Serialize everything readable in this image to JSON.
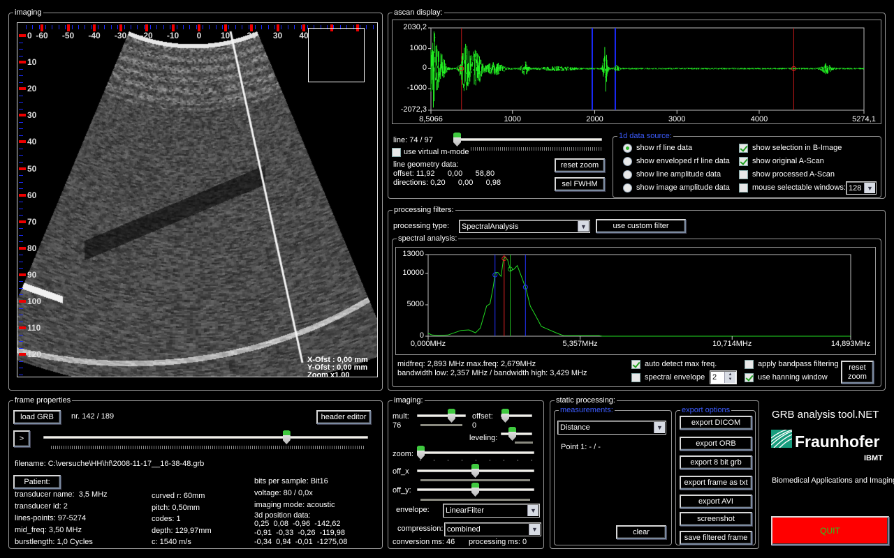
{
  "imaging_view": {
    "legend": "imaging",
    "x_ruler_labels": [
      "-60",
      "-50",
      "-40",
      "-30",
      "-20",
      "-10",
      "0",
      "10",
      "20",
      "30",
      "40"
    ],
    "y_ruler_labels": [
      "0",
      "10",
      "20",
      "30",
      "40",
      "50",
      "60",
      "70",
      "80",
      "90",
      "100",
      "110",
      "120"
    ],
    "x_offset": "X-Ofst : 0,00 mm",
    "y_offset": "Y-Ofst : 0,00 mm",
    "zoom": "Zoom x1,00"
  },
  "ascan": {
    "legend": "ascan display:",
    "y_labels": [
      "2030,2",
      "1000",
      "0",
      "-1000",
      "-2072,3"
    ],
    "x_labels": [
      "8,5066",
      "1000",
      "2000",
      "3000",
      "4000",
      "5274,1"
    ],
    "x_range": [
      8.5066,
      5274.1
    ],
    "y_range": [
      -2072.3,
      2030.2
    ],
    "red_markers": [
      380,
      4420
    ],
    "blue_markers": [
      1970,
      2250
    ],
    "line_label": "line: 74 / 97",
    "line_slider": 0.0,
    "virtual_mmode": {
      "label": "use virtual m-mode",
      "checked": false
    },
    "geometry_title": "line geometry data:",
    "offset": "offset: 11,92      0,00      58,80",
    "directions": "directions: 0,20      0,00      0,98",
    "reset_zoom": "reset zoom",
    "sel_fwhm": "sel FWHM",
    "source": {
      "legend": "1d data source:",
      "radios": [
        {
          "label": "show rf line data",
          "selected": true
        },
        {
          "label": "show enveloped rf line data",
          "selected": false
        },
        {
          "label": "show line amplitude data",
          "selected": false
        },
        {
          "label": "show image amplitude data",
          "selected": false
        }
      ],
      "checks": [
        {
          "label": "show selection in B-Image",
          "checked": true
        },
        {
          "label": "show original A-Scan",
          "checked": true
        },
        {
          "label": "show processed A-Scan",
          "checked": false
        },
        {
          "label": "mouse selectable windows:",
          "checked": false
        }
      ],
      "window_size": "128"
    }
  },
  "filters": {
    "legend": "processing filters:",
    "type_label": "processing type:",
    "type_value": "SpectralAnalysis",
    "custom_filter": "use custom filter",
    "spectral": {
      "legend": "spectral analysis:",
      "y_labels": [
        "13000",
        "10000",
        "5000",
        "0"
      ],
      "x_labels": [
        "0,000MHz",
        "5,357MHz",
        "10,714MHz",
        "14,893MHz"
      ],
      "midfreq_line": "midfreq: 2,893 MHz  max.freq: 2,679MHz",
      "bandwidth_line": "bandwidth low: 2,357 MHz / bandwidth high: 3,429 MHz",
      "auto_detect": {
        "label": "auto detect max freq.",
        "checked": true
      },
      "spectral_envelope": {
        "label": "spectral envelope",
        "checked": false
      },
      "envelope_value": "2",
      "bandpass": {
        "label": "apply bandpass filtering",
        "checked": false
      },
      "hanning": {
        "label": "use hanning window",
        "checked": true
      },
      "reset_zoom_1": "reset",
      "reset_zoom_2": "zoom"
    }
  },
  "chart_data": {
    "type": "line",
    "xlabel": "",
    "ylabel": "",
    "xlim": [
      0,
      14.893
    ],
    "ylim": [
      0,
      13000
    ],
    "x": [
      0,
      0.14,
      0.36,
      0.7,
      1.16,
      1.44,
      1.67,
      1.84,
      2.06,
      2.18,
      2.29,
      2.37,
      2.46,
      2.57,
      2.65,
      2.71,
      2.8,
      2.91,
      3.03,
      3.14,
      3.25,
      3.45,
      3.6,
      3.76,
      3.99,
      4.22,
      4.56,
      4.78,
      6.03,
      6.14,
      14.893
    ],
    "values": [
      440,
      185,
      110,
      185,
      920,
      1000,
      550,
      1290,
      4800,
      5170,
      7750,
      10150,
      10150,
      9530,
      12190,
      12560,
      12190,
      10400,
      10700,
      11260,
      9970,
      7570,
      4800,
      3510,
      1550,
      1100,
      440,
      74,
      74,
      0,
      0
    ],
    "markers": {
      "bandwidth_low": 2.357,
      "max_freq": 2.679,
      "midfreq": 2.893,
      "bandwidth_high": 3.429
    },
    "colors": {
      "curve": "#22dd22",
      "bandwidth": "#2233ff",
      "max": "#dd2222",
      "mid": "#22bb22"
    }
  },
  "frame": {
    "legend": "frame properties",
    "load": "load GRB",
    "nr": "nr. 142 / 189",
    "header_editor": "header editor",
    "play": ">",
    "frame_slider": 0.75,
    "filename": "filename: C:\\versuche\\HH\\hf\\2008-11-17__16-38-48.grb",
    "patient": "Patient:",
    "col1": [
      "transducer name:  3,5 MHz",
      "transducer id: 2",
      "lines-points: 97-5274",
      "mid_freq: 3,50 MHz",
      "burstlength: 1,0 Cycles"
    ],
    "col2": [
      "curved r: 60mm",
      "pitch: 0,50mm",
      "codes: 1",
      "depth: 129,97mm",
      "c: 1540 m/s"
    ],
    "col3": [
      "bits per sample: Bit16",
      "voltage: 80 / 0,0x",
      "imaging mode: acoustic",
      "3d position data:",
      "0,25  0,08  -0,96  -142,62",
      "-0,91  -0,33  -0,26  -119,98",
      "-0,34  0,94  -0,01  -1275,08"
    ]
  },
  "imaging_ctrl": {
    "legend": "imaging:",
    "mult_label": "mult:",
    "mult_value": "76",
    "offset_label": "offset:",
    "offset_value": "0",
    "leveling_label": "leveling:",
    "zoom_label": "zoom:",
    "offx_label": "off_x",
    "offy_label": "off_y:",
    "envelope_label": "envelope:",
    "envelope_value": "LinearFilter",
    "compression_label": "compression:",
    "compression_value": "combined",
    "conversion": "conversion ms: 46",
    "processing": "processing ms: 0"
  },
  "static": {
    "legend": "static processing:",
    "measurements_legend": "measurements:",
    "measure_type": "Distance",
    "point1": "Point 1: - / -",
    "clear": "clear",
    "export_legend": "export options",
    "exports": [
      "export DICOM",
      "export ORB",
      "export 8 bit grb",
      "export frame as txt",
      "export AVI",
      "screenshot",
      "save filtered frame"
    ]
  },
  "branding": {
    "app_title": "GRB analysis tool.NET",
    "logo_text": "Fraunhofer",
    "logo_sub": "IBMT",
    "tagline": "Biomedical Applications and Imaging",
    "quit": "QUIT",
    "quit_color": "#ff0000",
    "quit_text_color": "#22cc22"
  }
}
